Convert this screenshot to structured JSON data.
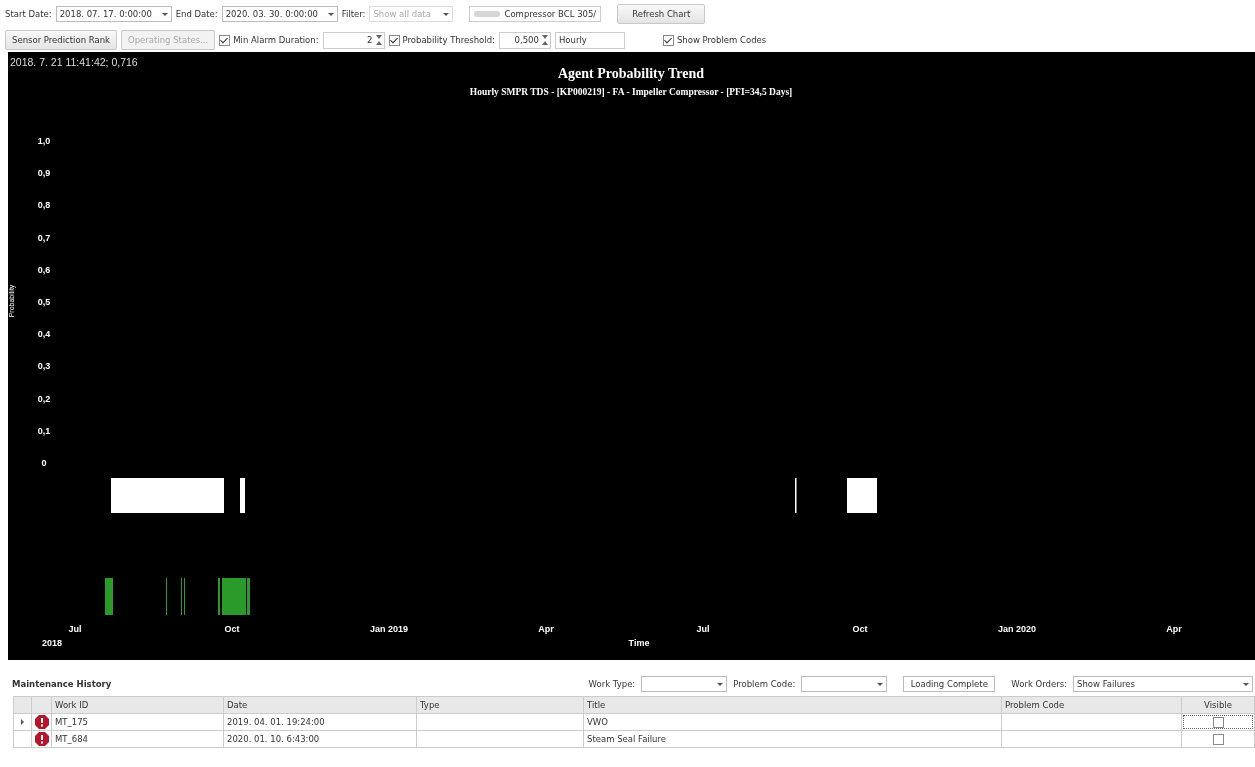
{
  "toolbar": {
    "start_date": {
      "label": "Start Date:",
      "value": "2018. 07. 17. 0:00:00"
    },
    "end_date": {
      "label": "End Date:",
      "value": "2020. 03. 30. 0:00:00"
    },
    "filter": {
      "label": "Filter:",
      "value": "Show all data",
      "disabled": true
    },
    "asset": "Compressor BCL 305/",
    "refresh_button": "Refresh Chart"
  },
  "options": {
    "buttons": [
      {
        "label": "Sensor Prediction Rank",
        "disabled": false
      },
      {
        "label": "Operating States...",
        "disabled": true
      }
    ],
    "min_alarm_duration": {
      "label": "Min Alarm Duration:",
      "checked": true,
      "value": "2"
    },
    "probability_threshold": {
      "label": "Probability Threshold:",
      "checked": true,
      "value": "0,500"
    },
    "interval": "Hourly",
    "show_problem_codes": {
      "label": "Show Problem Codes",
      "checked": true
    }
  },
  "chart": {
    "readout": "2018. 7. 21 11:41:42; 0,716",
    "title": "Agent Probability Trend",
    "subtitle": "Hourly SMPR TDS - [KP000219] - FA - Impeller Compressor - [PFI=34,5 Days]",
    "axis_title": "Time",
    "y_axis_title": "Probability",
    "y_axis_labels": [
      "1,0",
      "0,9",
      "0,8",
      "0,7",
      "0,6",
      "0,5",
      "0,4",
      "0,3",
      "0,2",
      "0,1",
      "0"
    ],
    "x_axis_labels": [
      "Jul",
      "Oct",
      "Jan 2019",
      "Apr",
      "Jul",
      "Oct",
      "Jan 2020",
      "Apr"
    ],
    "year_label": "2018"
  },
  "maintenance": {
    "title": "Maintenance History",
    "filters": [
      {
        "label": "Work Type:"
      },
      {
        "label": "Problem Code:"
      }
    ],
    "status": "Loading Complete",
    "work_orders": {
      "label": "Work Orders:",
      "value": "Show Failures"
    },
    "columns": [
      "Work ID",
      "Date",
      "Type",
      "Title",
      "Problem Code",
      "Visible"
    ],
    "rows": [
      {
        "expandable": true,
        "alert": true,
        "work_id": "MT_175",
        "date": "2019. 04. 01. 19:24:00",
        "title": "VWO",
        "visible": false,
        "focused": true
      },
      {
        "expandable": false,
        "alert": true,
        "work_id": "MT_684",
        "date": "2020. 01. 10. 6:43:00",
        "title": "Steam Seal Failure",
        "visible": false,
        "focused": false
      }
    ]
  }
}
